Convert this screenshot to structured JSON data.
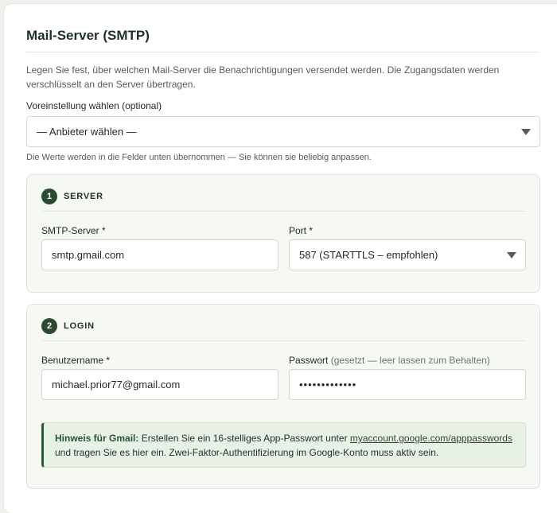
{
  "panel": {
    "title": "Mail-Server (SMTP)",
    "intro": "Legen Sie fest, über welchen Mail-Server die Benachrichtigungen versendet werden. Die Zugangsdaten werden verschlüsselt an den Server übertragen."
  },
  "preset": {
    "label": "Voreinstellung wählen (optional)",
    "selected": "— Anbieter wählen —",
    "helper": "Die Werte werden in die Felder unten übernommen — Sie können sie beliebig anpassen."
  },
  "server": {
    "step": "1",
    "title": "SERVER",
    "smtp_label": "SMTP-Server *",
    "smtp_value": "smtp.gmail.com",
    "port_label": "Port *",
    "port_selected": "587 (STARTTLS – empfohlen)"
  },
  "login": {
    "step": "2",
    "title": "LOGIN",
    "user_label": "Benutzername *",
    "user_value": "michael.prior77@gmail.com",
    "pass_label": "Passwort",
    "pass_note": "(gesetzt — leer lassen zum Behalten)",
    "pass_value": "•••••••••••••"
  },
  "hint": {
    "strong": "Hinweis für Gmail:",
    "text_before_link": "Erstellen Sie ein 16-stelliges App-Passwort unter",
    "link": "myaccount.google.com/apppasswords",
    "text_after_link": "und tragen Sie es hier ein. Zwei-Faktor-Authentifizierung im Google-Konto muss aktiv sein."
  },
  "colors": {
    "accent": "#2b4a32",
    "section_bg": "#f5f8f3",
    "hint_bg": "#e7f1e5"
  },
  "icons": {
    "dropdown": "caret-down-icon"
  }
}
